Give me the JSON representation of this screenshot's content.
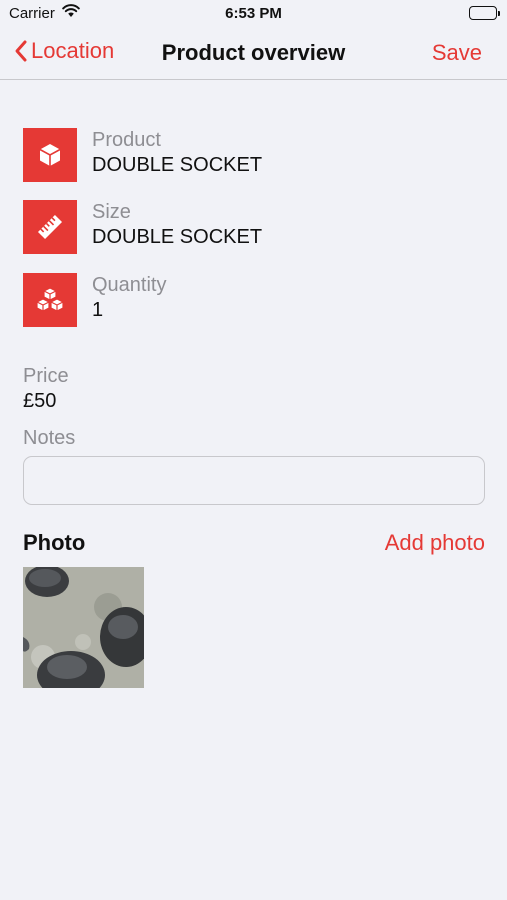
{
  "status_bar": {
    "carrier": "Carrier",
    "time": "6:53 PM"
  },
  "nav": {
    "back_label": "Location",
    "title": "Product overview",
    "save_label": "Save"
  },
  "details": [
    {
      "label": "Product",
      "value": "DOUBLE SOCKET",
      "icon": "cube-icon"
    },
    {
      "label": "Size",
      "value": "DOUBLE SOCKET",
      "icon": "ruler-icon"
    },
    {
      "label": "Quantity",
      "value": "1",
      "icon": "boxes-icon"
    }
  ],
  "price": {
    "label": "Price",
    "value": "£50"
  },
  "notes": {
    "label": "Notes",
    "value": "",
    "placeholder": ""
  },
  "photo": {
    "heading": "Photo",
    "add_label": "Add photo"
  },
  "colors": {
    "accent": "#e53935",
    "background": "#f1f2f7",
    "secondary_text": "#8e8e93"
  }
}
